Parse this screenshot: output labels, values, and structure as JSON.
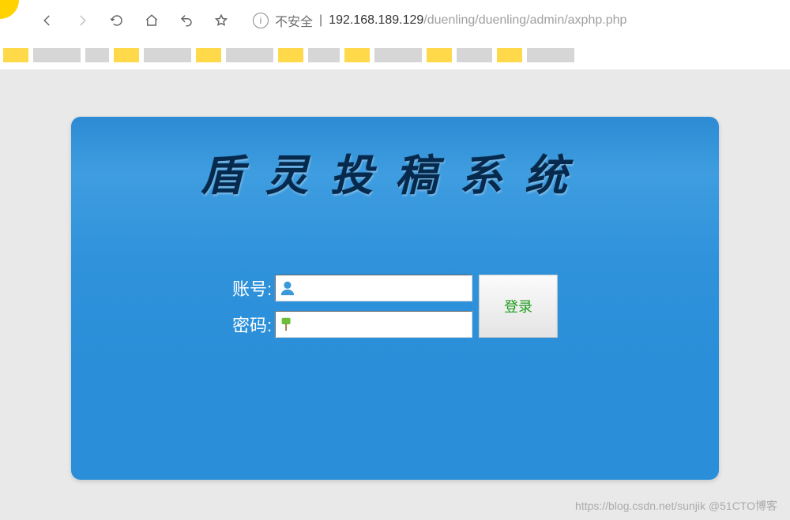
{
  "browser": {
    "security_label": "不安全",
    "divider": " | ",
    "url_ip": "192.168.189.129",
    "url_path": "/duenling/duenling/admin/axphp.php"
  },
  "card": {
    "title": "盾灵投稿系统"
  },
  "form": {
    "username_label": "账号:",
    "password_label": "密码:",
    "login_btn": "登录",
    "username_value": "",
    "password_value": ""
  },
  "watermark": "https://blog.csdn.net/sunjik @51CTO博客"
}
